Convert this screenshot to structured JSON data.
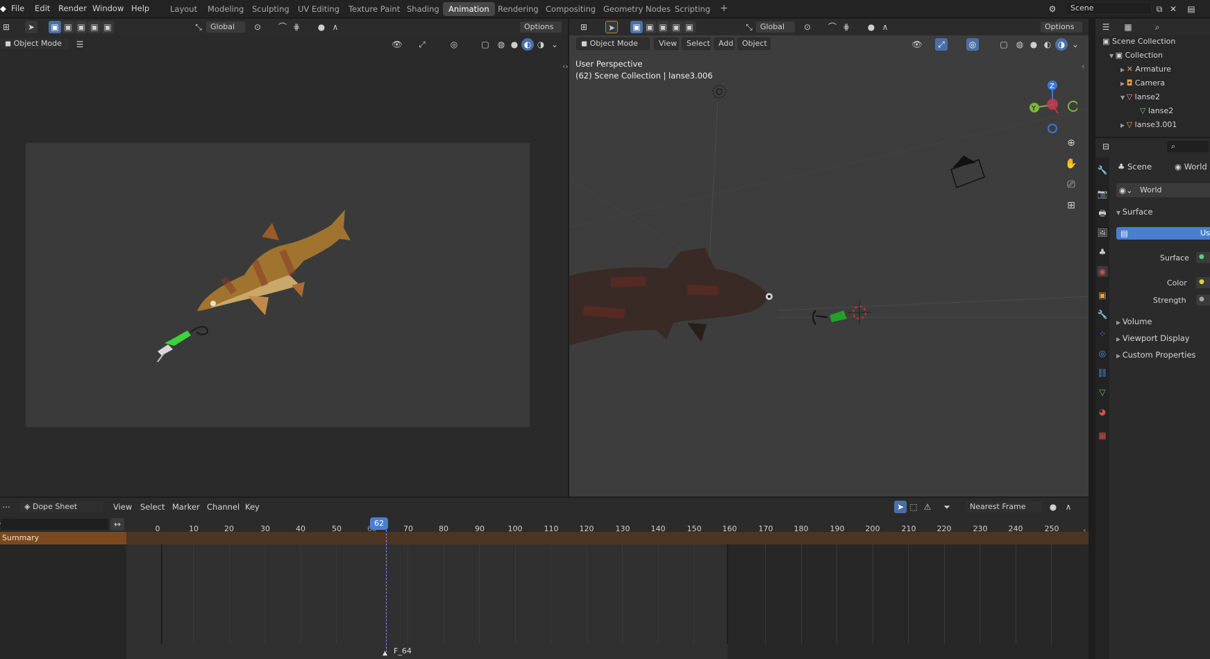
{
  "menu": [
    "File",
    "Edit",
    "Render",
    "Window",
    "Help"
  ],
  "workspaces": [
    "Layout",
    "Modeling",
    "Sculpting",
    "UV Editing",
    "Texture Paint",
    "Shading",
    "Animation",
    "Rendering",
    "Compositing",
    "Geometry Nodes",
    "Scripting"
  ],
  "active_workspace": "Animation",
  "add_tab": "+",
  "scene_name": "Scene",
  "left_viewport": {
    "transform": "Global",
    "options": "Options",
    "mode": "Object Mode"
  },
  "right_viewport": {
    "transform": "Global",
    "options": "Options",
    "mode": "Object Mode",
    "menus": [
      "View",
      "Select",
      "Add",
      "Object"
    ],
    "overlay_line1": "User Perspective",
    "overlay_line2": "(62) Scene Collection | lanse3.006",
    "gizmo": {
      "z": "Z",
      "y": "Y",
      "x": "X"
    }
  },
  "outliner": {
    "root": "Scene Collection",
    "collection": "Collection",
    "items": [
      {
        "label": "Armature",
        "level": 2,
        "icon": "armature-icon"
      },
      {
        "label": "Camera",
        "level": 2,
        "icon": "camera-icon"
      },
      {
        "label": "lanse2",
        "level": 2,
        "icon": "mesh-icon"
      },
      {
        "label": "lanse2",
        "level": 3,
        "icon": "mesh-data-icon"
      },
      {
        "label": "lanse3.001",
        "level": 2,
        "icon": "mesh-icon"
      }
    ]
  },
  "properties": {
    "scene_label": "Scene",
    "world_tab": "World",
    "world_name": "World",
    "surface_panel": "Surface",
    "use_nodes_partial": "Us",
    "surface_label": "Surface",
    "color_label": "Color",
    "strength_label": "Strength",
    "collapsed_panels": [
      "Volume",
      "Viewport Display",
      "Custom Properties"
    ]
  },
  "dopesheet": {
    "editor": "Dope Sheet",
    "menus": [
      "View",
      "Select",
      "Marker",
      "Channel",
      "Key"
    ],
    "snapping": "Nearest Frame",
    "search_value": "",
    "summary": "Summary",
    "current_frame": "62",
    "marker": "F_64",
    "ticks": [
      "0",
      "10",
      "20",
      "30",
      "40",
      "50",
      "60",
      "70",
      "80",
      "90",
      "100",
      "110",
      "120",
      "130",
      "140",
      "150",
      "160",
      "170",
      "180",
      "190",
      "200",
      "210",
      "220",
      "230",
      "240",
      "250"
    ]
  },
  "colors": {
    "accent": "#4a7fd0",
    "summary": "#7a4a1e",
    "active_tab": "#474747"
  }
}
